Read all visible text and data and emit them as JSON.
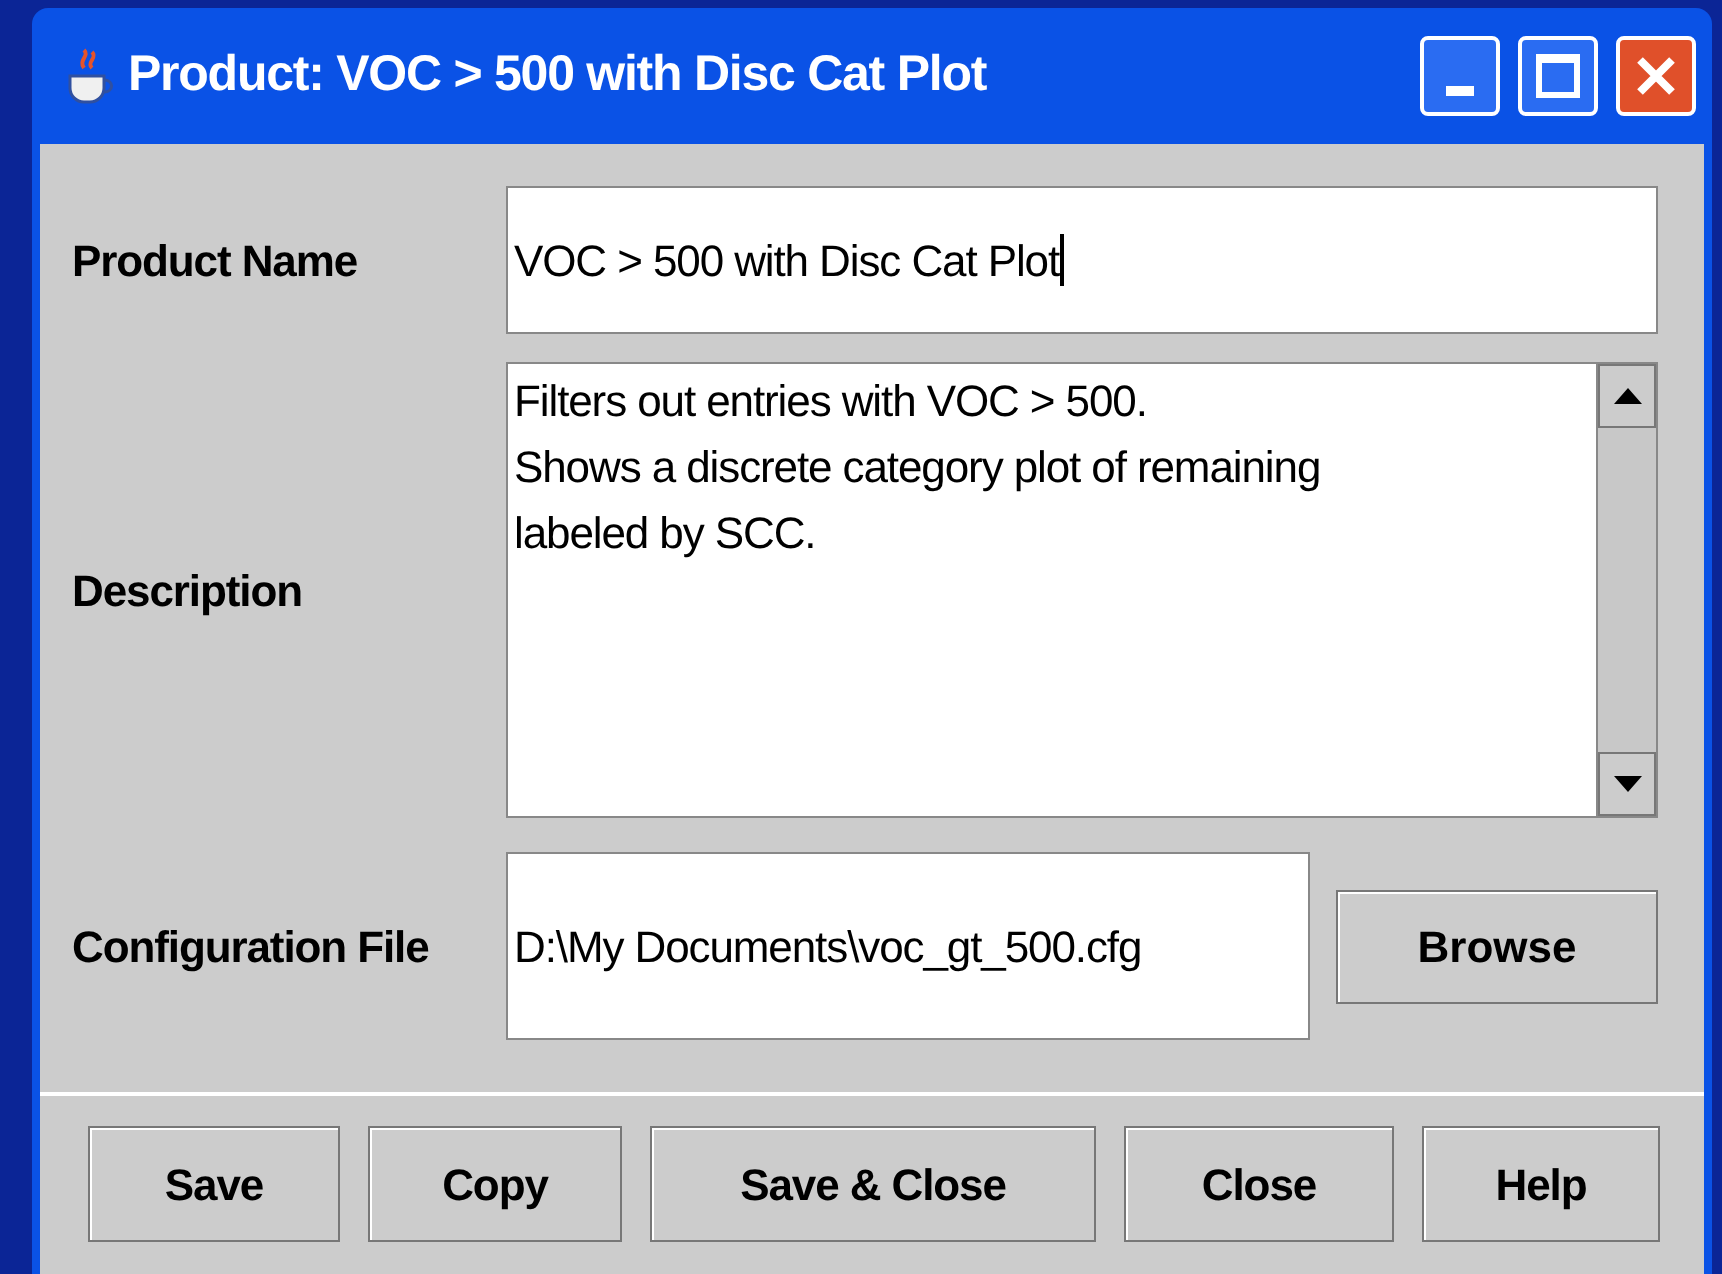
{
  "window": {
    "title": "Product: VOC > 500 with Disc Cat Plot"
  },
  "fields": [
    {
      "kind": "text",
      "label": "Product Name",
      "value": "VOC > 500 with Disc Cat Plot",
      "focused": true
    },
    {
      "kind": "textarea",
      "label": "Description",
      "value": "Filters out entries with VOC > 500.\nShows a discrete category plot of remaining\nlabeled by SCC."
    },
    {
      "kind": "file",
      "label": "Configuration File",
      "value": "D:\\My Documents\\voc_gt_500.cfg",
      "button": "Browse"
    }
  ],
  "buttons": [
    "Save",
    "Copy",
    "Save & Close",
    "Close",
    "Help"
  ]
}
